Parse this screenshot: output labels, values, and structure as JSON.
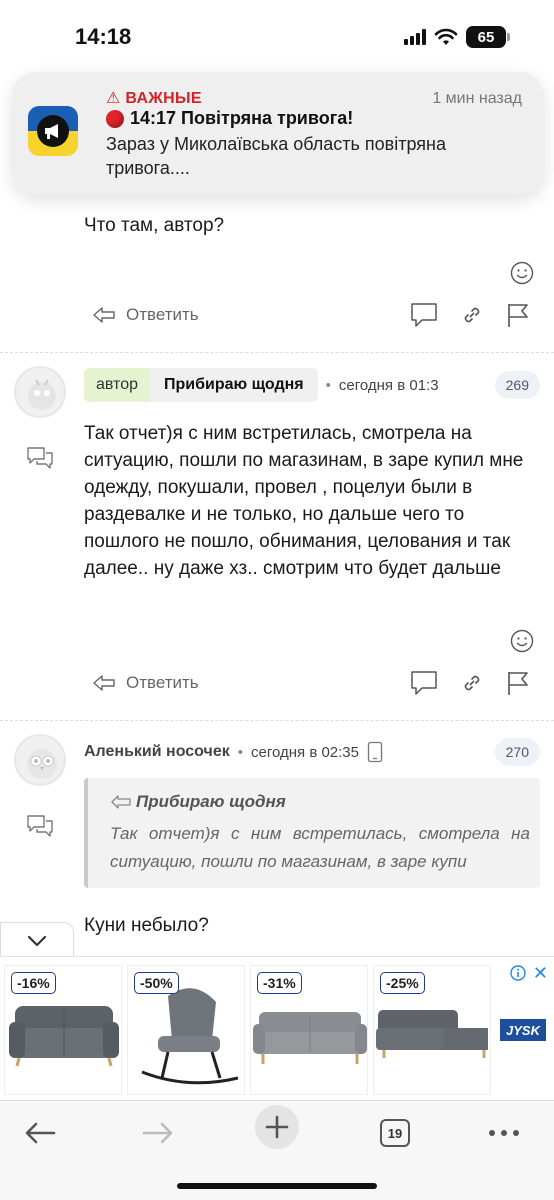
{
  "status_bar": {
    "time": "14:18",
    "battery": "65"
  },
  "notification": {
    "tag": "ВАЖНЫЕ",
    "time": "1 мин назад",
    "title": "14:17 Повітряна тривога!",
    "body": "Зараз у Миколаївська область повітряна тривога....",
    "icon": "air-raid-alert-app-icon"
  },
  "comments": [
    {
      "text": "Что там, автор?",
      "reply_label": "Ответить"
    },
    {
      "author_badge": "автор",
      "author": "Прибираю щодня",
      "timestamp": "сегодня в 01:3",
      "number": "269",
      "text": "Так отчет)я с ним встретилась, смотрела на ситуацию, пошли по магазинам, в заре купил мне одежду, покушали, провел , поцелуи были в раздевалке и не только, но дальше чего то пошлого не пошло, обнимания, целования и так далее.. ну даже хз.. смотрим что будет дальше",
      "reply_label": "Ответить"
    },
    {
      "author": "Аленький носочек",
      "timestamp": "сегодня в 02:35",
      "number": "270",
      "quote_author": "Прибираю щодня",
      "quote_text": "Так отчет)я с ним встретилась, смотрела на ситуацию, пошли по магазинам, в заре купи",
      "text": "Куни небыло?"
    }
  ],
  "ad": {
    "items": [
      {
        "discount": "-16%",
        "product": "grey-two-seat-sofa"
      },
      {
        "discount": "-50%",
        "product": "grey-rocking-chair"
      },
      {
        "discount": "-31%",
        "product": "grey-three-seat-sofa"
      },
      {
        "discount": "-25%",
        "product": "grey-corner-sofa"
      }
    ],
    "brand": "JYSK",
    "close_label": "✕"
  },
  "toolbar": {
    "tabs_count": "19"
  }
}
